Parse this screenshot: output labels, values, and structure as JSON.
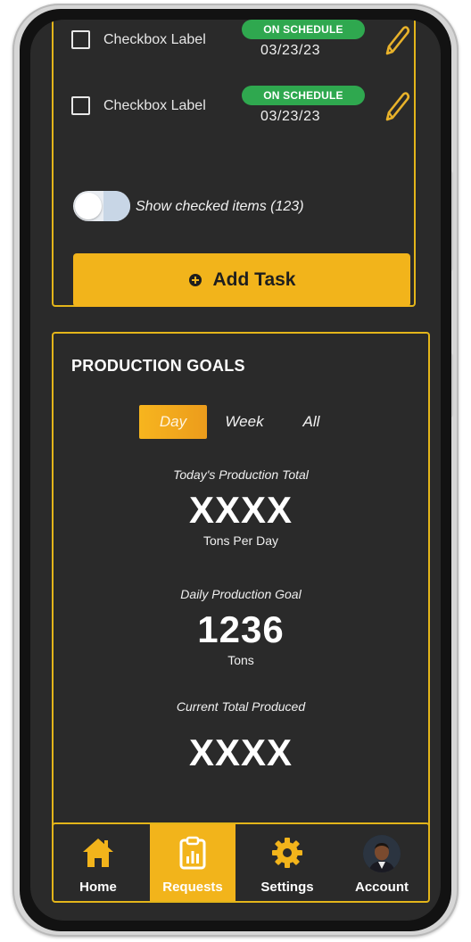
{
  "tasks": [
    {
      "label": "Checkbox Label",
      "status": "ON SCHEDULE",
      "date": "03/23/23"
    },
    {
      "label": "Checkbox Label",
      "status": "ON SCHEDULE",
      "date": "03/23/23"
    }
  ],
  "toggle": {
    "label": "Show checked items (123)",
    "checked": false
  },
  "add_task": {
    "label": "Add Task"
  },
  "production": {
    "title": "PRODUCTION GOALS",
    "tabs": [
      "Day",
      "Week",
      "All"
    ],
    "active_tab": "Day",
    "metrics": [
      {
        "label": "Today's Production Total",
        "value": "XXXX",
        "unit": "Tons Per Day"
      },
      {
        "label": "Daily Production Goal",
        "value": "1236",
        "unit": "Tons"
      },
      {
        "label": "Current Total Produced",
        "value": "XXXX",
        "unit": ""
      }
    ]
  },
  "nav": [
    {
      "label": "Home",
      "icon": "home-icon"
    },
    {
      "label": "Requests",
      "icon": "clipboard-chart-icon",
      "active": true
    },
    {
      "label": "Settings",
      "icon": "gear-icon"
    },
    {
      "label": "Account",
      "icon": "avatar"
    }
  ],
  "colors": {
    "accent": "#f2b41b",
    "badge": "#2fa84f",
    "background": "#2a2a2a"
  }
}
